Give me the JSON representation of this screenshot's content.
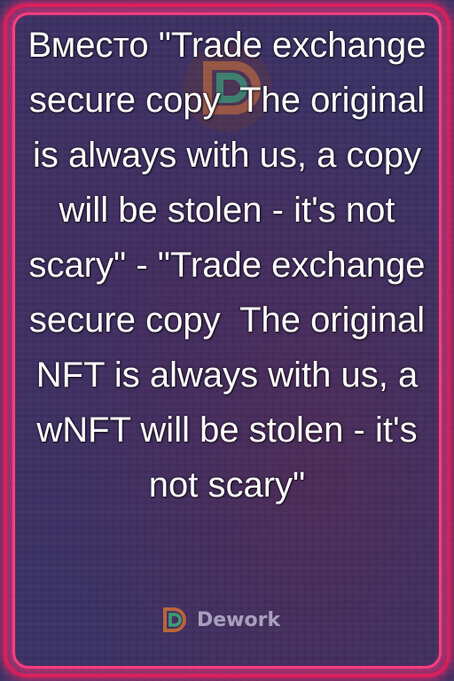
{
  "card": {
    "message": "Вместо \"Trade exchange secure copy  The original is always with us, a copy will be stolen - it's not scary\" - \"Trade exchange secure copy  The original NFT is always with us, a wNFT will be stolen - it's not scary\""
  },
  "watermark": {
    "brand": "Dework",
    "icon": "dework-logo-icon"
  },
  "colors": {
    "frame": "#d81e5b",
    "frame_glow": "#ff3d7f",
    "background": "#3b3366",
    "text": "#ffffff",
    "logo": "#e0762f"
  }
}
